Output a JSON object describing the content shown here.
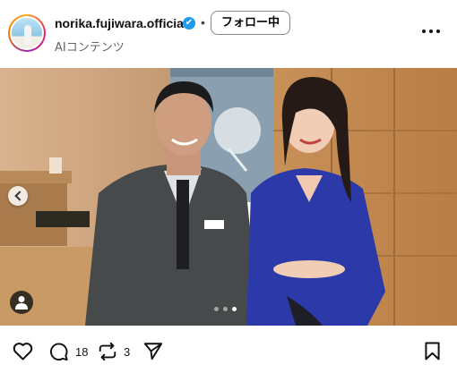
{
  "header": {
    "username": "norika.fujiwara.official",
    "verified_icon": "✔",
    "separator": "•",
    "follow_label": "フォロー中",
    "subtitle": "AIコンテンツ"
  },
  "carousel": {
    "current_index": 3,
    "total": 3
  },
  "actions": {
    "comment_count": "18",
    "repost_count": "3"
  },
  "colors": {
    "verified": "#1d9bf0",
    "wood": "#c9925a",
    "dress": "#2b3aa8"
  }
}
